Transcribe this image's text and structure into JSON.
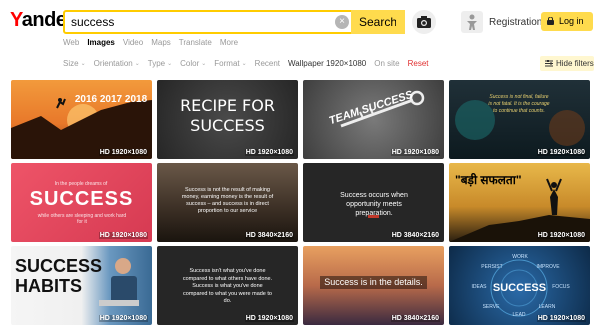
{
  "header": {
    "logo_first": "Y",
    "logo_rest": "andex",
    "search_value": "success",
    "search_button": "Search",
    "clear_symbol": "×",
    "registration": "Registration",
    "login": "Log in"
  },
  "tabs": [
    "Web",
    "Images",
    "Video",
    "Maps",
    "Translate",
    "More"
  ],
  "filters": {
    "selects": [
      "Size",
      "Orientation",
      "Type",
      "Color",
      "Format"
    ],
    "recent": "Recent",
    "wallpaper": "Wallpaper 1920×1080",
    "on_site": "On site",
    "reset": "Reset",
    "hide_filters": "Hide filters",
    "chevron": "⌄"
  },
  "images": [
    {
      "badge": "HD 1920×1080",
      "text": "2016 2017 2018",
      "colors": [
        "#e8782a",
        "#c45a1e"
      ]
    },
    {
      "badge": "HD 1920×1080",
      "text": "RECIPE FOR SUCCESS",
      "colors": [
        "#3a3a3a",
        "#2a2a2a"
      ]
    },
    {
      "badge": "HD 1920×1080",
      "text": "TEAM SUCCESS",
      "colors": [
        "#6a6a6a",
        "#4a4a4a"
      ]
    },
    {
      "badge": "HD 1920×1080",
      "text": "Success is not final, failure is not fatal. It is the courage to continue that counts.",
      "colors": [
        "#1e2a30",
        "#0f1a20"
      ]
    },
    {
      "badge": "HD 1920×1080",
      "text": "Success",
      "sub": "while others are sleeping and work hard for it",
      "top": "In the people dreams of",
      "colors": [
        "#e8495e",
        "#d63a52"
      ]
    },
    {
      "badge": "HD 3840×2160",
      "text": "Success is not the result of making money, earning money is the result of success – and success is in direct proportion to our service",
      "colors": [
        "#5a4a3a",
        "#2a2018"
      ]
    },
    {
      "badge": "HD 3840×2160",
      "text": "Success occurs when opportunity meets preparation.",
      "colors": [
        "#2c2c2c",
        "#1f1f1f"
      ]
    },
    {
      "badge": "HD 1920×1080",
      "text": "\"बड़ी सफलता\"",
      "colors": [
        "#d8a02a",
        "#3a2a18"
      ]
    },
    {
      "badge": "HD 1920×1080",
      "text": "SUCCESS HABITS",
      "colors": [
        "#f0f0f0",
        "#5a8ab0"
      ]
    },
    {
      "badge": "HD 1920×1080",
      "text": "Success isn't what you've done compared to what others have done. Success is what you've done compared to what you were made to do.",
      "colors": [
        "#2a2a2a",
        "#1a1a1a"
      ]
    },
    {
      "badge": "HD 3840×2160",
      "text": "Success is in the details.",
      "colors": [
        "#d88a50",
        "#3a2a40"
      ]
    },
    {
      "badge": "HD 1920×1080",
      "text": "SUCCESS",
      "words": [
        "WORK",
        "IMPROVE",
        "PERSIST",
        "IDEAS",
        "FOCUS",
        "SERVE",
        "LEARN",
        "LEAD"
      ],
      "colors": [
        "#1d4a78",
        "#0d2a48"
      ]
    }
  ]
}
